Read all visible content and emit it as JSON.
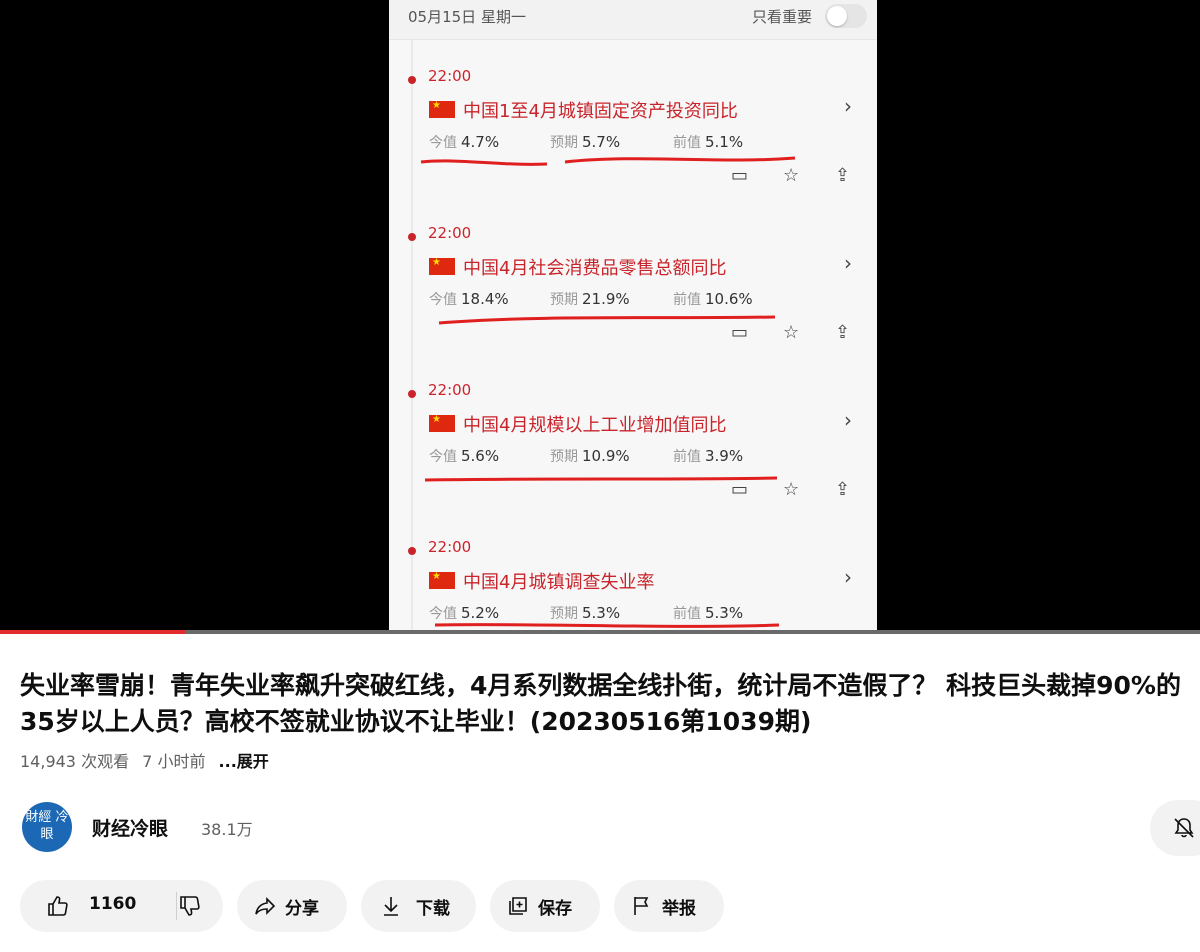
{
  "player": {
    "date": "05月15日 星期一",
    "important_only": "只看重要",
    "labels": {
      "now": "今值",
      "expected": "预期",
      "previous": "前值"
    },
    "items": [
      {
        "time": "22:00",
        "title": "中国1至4月城镇固定资产投资同比",
        "now": "4.7%",
        "expected": "5.7%",
        "previous": "5.1%"
      },
      {
        "time": "22:00",
        "title": "中国4月社会消费品零售总额同比",
        "now": "18.4%",
        "expected": "21.9%",
        "previous": "10.6%"
      },
      {
        "time": "22:00",
        "title": "中国4月规模以上工业增加值同比",
        "now": "5.6%",
        "expected": "10.9%",
        "previous": "3.9%"
      },
      {
        "time": "22:00",
        "title": "中国4月城镇调查失业率",
        "now": "5.2%",
        "expected": "5.3%",
        "previous": "5.3%"
      }
    ],
    "progress_fraction": 0.154,
    "colors": {
      "accent_red": "#c9242b",
      "progress_red": "#e22b2b"
    }
  },
  "video": {
    "title": "失业率雪崩！青年失业率飙升突破红线，4月系列数据全线扑街，统计局不造假了？ 科技巨头裁掉90%的35岁以上人员？高校不签就业协议不让毕业！(20230516第1039期)",
    "views": "14,943 次观看",
    "age": "7 小时前",
    "expand": "...展开"
  },
  "channel": {
    "avatar_text": "財經 冷眼",
    "name": "财经冷眼",
    "subscribers": "38.1万",
    "avatar_color": "#1c68b5"
  },
  "actions": {
    "like_count": "1160",
    "share": "分享",
    "download": "下载",
    "save": "保存",
    "report": "举报"
  },
  "icons": [
    "thumb-up-icon",
    "thumb-down-icon",
    "share-icon",
    "download-icon",
    "save-playlist-icon",
    "flag-icon",
    "bell-off-icon",
    "chevron-right-icon",
    "comment-icon",
    "star-icon",
    "upload-icon"
  ]
}
